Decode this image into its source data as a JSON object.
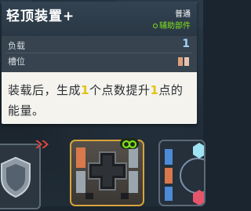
{
  "tooltip": {
    "title": "轻顶装置+",
    "rarity": "普通",
    "category": "辅助部件",
    "stats": [
      {
        "label": "负载",
        "value": "1"
      },
      {
        "label": "槽位",
        "value": ""
      }
    ],
    "description": {
      "part1": "装载后，生成",
      "num1": "1",
      "part2": "个点数提升",
      "num2": "1",
      "part3": "点的能量。"
    }
  },
  "colors": {
    "highlight": "#e2c314",
    "category": "#7fe21b",
    "stat_value": "#9fd0ff",
    "selected_border": "#d8a43a"
  },
  "icons": {
    "left_slot": "shield-icon",
    "arrows": "double-chevron-right-icon",
    "mid_slot": "dpad-cross-icon",
    "link_badge": "link-icon",
    "right_slot": "hexagon-gem-icon"
  }
}
